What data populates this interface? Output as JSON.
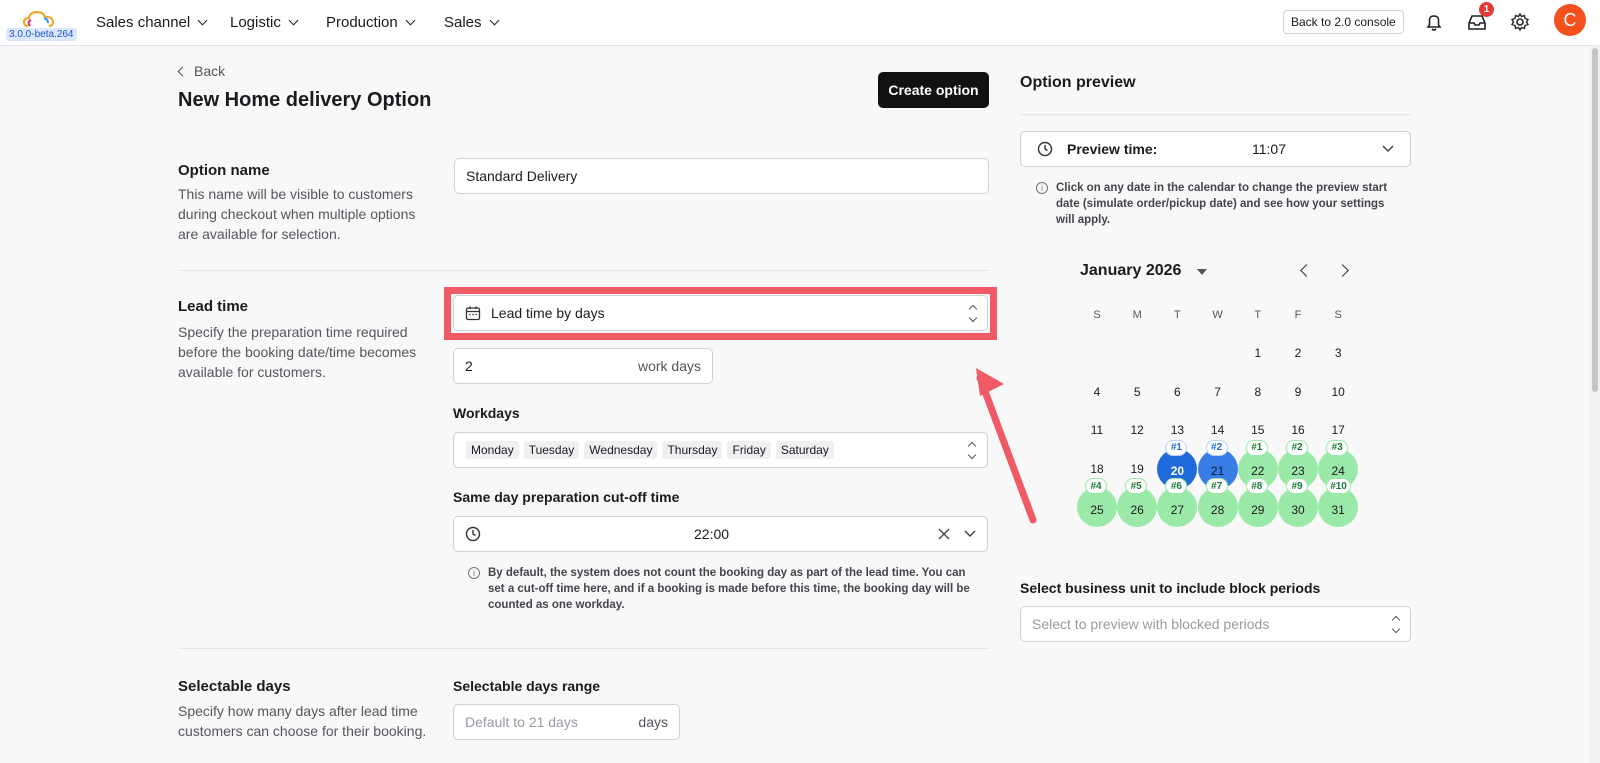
{
  "app": {
    "version": "3.0.0-beta.264",
    "nav": [
      "Sales channel",
      "Logistic",
      "Production",
      "Sales"
    ],
    "console_button": "Back to 2.0 console",
    "inbox_badge": "1",
    "avatar_letter": "C",
    "colors": {
      "accent_blue": "#1f6bdb",
      "green": "#9be9a8",
      "highlight": "#ef5a64",
      "avatar": "#f5511e"
    }
  },
  "header": {
    "back": "Back",
    "title": "New Home delivery Option",
    "create_button": "Create option"
  },
  "option_name": {
    "title": "Option name",
    "description": "This name will be visible to customers during checkout when multiple options are available for selection.",
    "value": "Standard Delivery"
  },
  "lead_time": {
    "title": "Lead time",
    "description": "Specify the preparation time required before the booking date/time becomes available for customers.",
    "mode": "Lead time by days",
    "days_value": "2",
    "days_suffix": "work days",
    "workdays_label": "Workdays",
    "workdays": [
      "Monday",
      "Tuesday",
      "Wednesday",
      "Thursday",
      "Friday",
      "Saturday"
    ],
    "cutoff_label": "Same day preparation cut-off time",
    "cutoff_value": "22:00",
    "cutoff_note": "By default, the system does not count the booking day as part of the lead time. You can set a cut-off time here, and if a booking is made before this time, the booking day will be counted as one workday."
  },
  "selectable_days": {
    "title": "Selectable days",
    "description": "Specify how many days after lead time customers can choose for their booking.",
    "range_label": "Selectable days range",
    "range_placeholder": "Default to 21 days",
    "range_suffix": "days"
  },
  "preview": {
    "title": "Option preview",
    "time_label": "Preview time:",
    "time_value": "11:07",
    "note": "Click on any date in the calendar to change the preview start date (simulate order/pickup date) and see how your settings will apply.",
    "month": "January 2026",
    "weekdays": [
      "S",
      "M",
      "T",
      "W",
      "T",
      "F",
      "S"
    ],
    "business_unit_label": "Select business unit to include block periods",
    "business_unit_placeholder": "Select to preview with blocked periods"
  },
  "calendar_days": [
    {
      "d": "1",
      "col": 4,
      "row": 0
    },
    {
      "d": "2",
      "col": 5,
      "row": 0
    },
    {
      "d": "3",
      "col": 6,
      "row": 0
    },
    {
      "d": "4",
      "col": 0,
      "row": 1
    },
    {
      "d": "5",
      "col": 1,
      "row": 1
    },
    {
      "d": "6",
      "col": 2,
      "row": 1
    },
    {
      "d": "7",
      "col": 3,
      "row": 1
    },
    {
      "d": "8",
      "col": 4,
      "row": 1
    },
    {
      "d": "9",
      "col": 5,
      "row": 1
    },
    {
      "d": "10",
      "col": 6,
      "row": 1
    },
    {
      "d": "11",
      "col": 0,
      "row": 2
    },
    {
      "d": "12",
      "col": 1,
      "row": 2
    },
    {
      "d": "13",
      "col": 2,
      "row": 2
    },
    {
      "d": "14",
      "col": 3,
      "row": 2
    },
    {
      "d": "15",
      "col": 4,
      "row": 2
    },
    {
      "d": "16",
      "col": 5,
      "row": 2
    },
    {
      "d": "17",
      "col": 6,
      "row": 2
    },
    {
      "d": "18",
      "col": 0,
      "row": 3
    },
    {
      "d": "19",
      "col": 1,
      "row": 3
    },
    {
      "d": "20",
      "col": 2,
      "row": 3,
      "state": "selected",
      "tag": "#1"
    },
    {
      "d": "21",
      "col": 3,
      "row": 3,
      "state": "lead",
      "tag": "#2"
    },
    {
      "d": "22",
      "col": 4,
      "row": 3,
      "state": "available",
      "tag": "#1"
    },
    {
      "d": "23",
      "col": 5,
      "row": 3,
      "state": "available",
      "tag": "#2"
    },
    {
      "d": "24",
      "col": 6,
      "row": 3,
      "state": "available",
      "tag": "#3"
    },
    {
      "d": "25",
      "col": 0,
      "row": 4,
      "state": "available",
      "tag": "#4"
    },
    {
      "d": "26",
      "col": 1,
      "row": 4,
      "state": "available",
      "tag": "#5"
    },
    {
      "d": "27",
      "col": 2,
      "row": 4,
      "state": "available",
      "tag": "#6"
    },
    {
      "d": "28",
      "col": 3,
      "row": 4,
      "state": "available",
      "tag": "#7"
    },
    {
      "d": "29",
      "col": 4,
      "row": 4,
      "state": "available",
      "tag": "#8"
    },
    {
      "d": "30",
      "col": 5,
      "row": 4,
      "state": "available",
      "tag": "#9"
    },
    {
      "d": "31",
      "col": 6,
      "row": 4,
      "state": "available",
      "tag": "#10"
    }
  ]
}
